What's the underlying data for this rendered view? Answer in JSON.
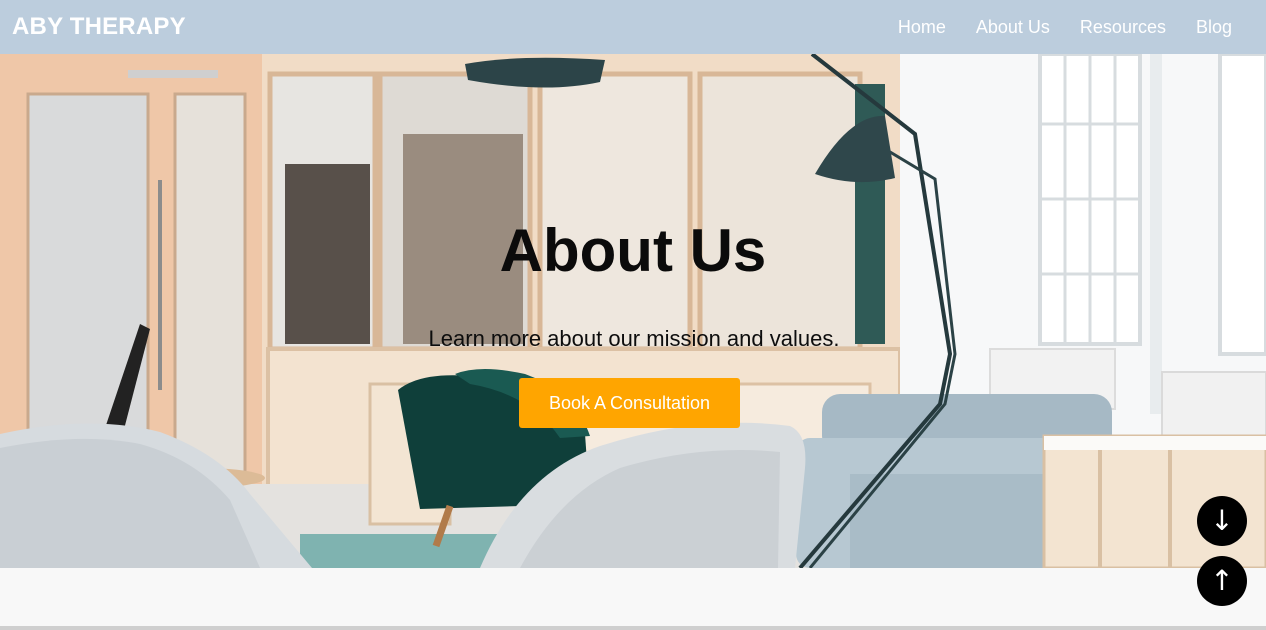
{
  "navbar": {
    "brand": "ABY THERAPY",
    "links": [
      {
        "label": "Home"
      },
      {
        "label": "About Us"
      },
      {
        "label": "Resources"
      },
      {
        "label": "Blog"
      }
    ]
  },
  "hero": {
    "title": "About Us",
    "subtitle": "Learn more about our mission and values.",
    "cta_label": "Book A Consultation"
  },
  "floating_buttons": {
    "scroll_down_icon": "↓",
    "scroll_up_icon": "↑"
  },
  "colors": {
    "navbar_bg": "#bccddd",
    "cta_bg": "#ffa500",
    "fab_bg": "#000000"
  }
}
